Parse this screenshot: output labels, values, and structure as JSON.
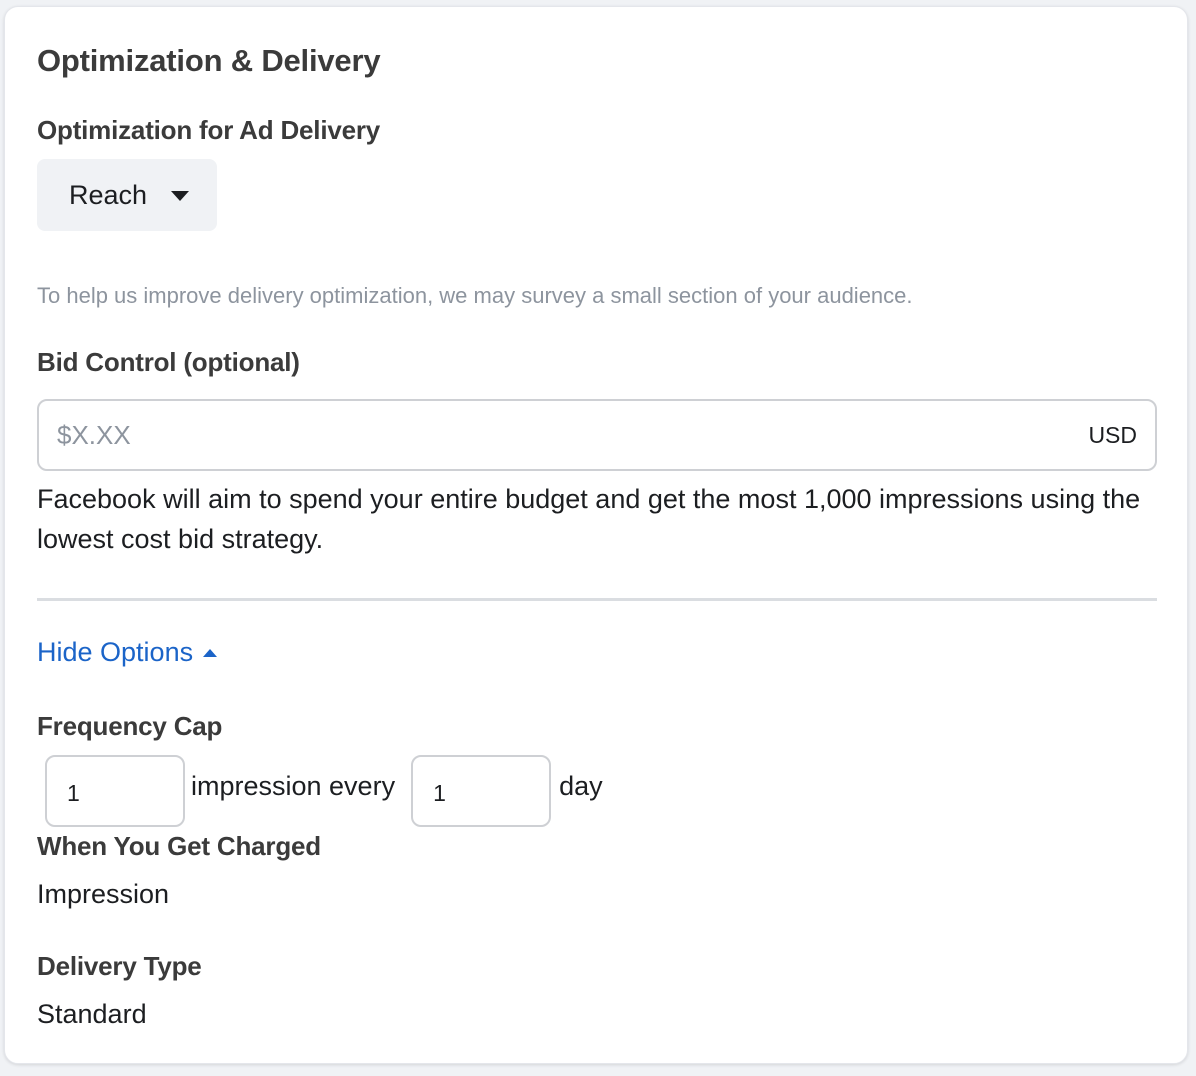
{
  "section": {
    "title": "Optimization & Delivery"
  },
  "optimization": {
    "label": "Optimization for Ad Delivery",
    "selected": "Reach",
    "hint": "To help us improve delivery optimization, we may survey a small section of your audience."
  },
  "bid_control": {
    "label": "Bid Control (optional)",
    "placeholder": "$X.XX",
    "value": "",
    "currency": "USD",
    "description": "Facebook will aim to spend your entire budget and get the most 1,000 impressions using the lowest cost bid strategy."
  },
  "options_toggle": {
    "label": "Hide Options"
  },
  "frequency_cap": {
    "label": "Frequency Cap",
    "impressions_value": "1",
    "middle_text": "impression every",
    "days_value": "1",
    "unit_text": "day"
  },
  "charging": {
    "label": "When You Get Charged",
    "value": "Impression"
  },
  "delivery_type": {
    "label": "Delivery Type",
    "value": "Standard"
  },
  "colors": {
    "link": "#1b64c8",
    "hint": "#8d949e",
    "heading": "#3b3b3b",
    "dropdown_bg": "#f0f2f5"
  },
  "icons": {
    "dropdown": "caret-down-icon",
    "toggle": "caret-up-icon"
  }
}
